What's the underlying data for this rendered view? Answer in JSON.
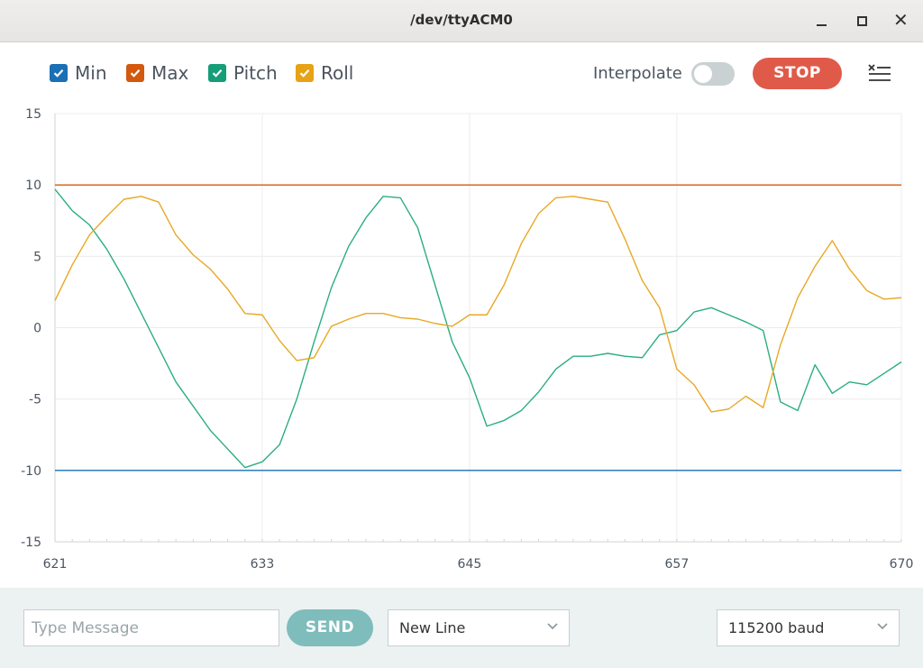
{
  "window": {
    "title": "/dev/ttyACM0"
  },
  "legend": [
    {
      "label": "Min",
      "color": "#1a6fb5"
    },
    {
      "label": "Max",
      "color": "#d3590e"
    },
    {
      "label": "Pitch",
      "color": "#159e78"
    },
    {
      "label": "Roll",
      "color": "#e8a215"
    }
  ],
  "toolbar": {
    "interpolate_label": "Interpolate",
    "interpolate_on": false,
    "stop_label": "STOP"
  },
  "bottom": {
    "message_placeholder": "Type Message",
    "send_label": "SEND",
    "line_ending": "New Line",
    "baud": "115200 baud"
  },
  "chart_data": {
    "type": "line",
    "x": [
      621,
      622,
      623,
      624,
      625,
      626,
      627,
      628,
      629,
      630,
      631,
      632,
      633,
      634,
      635,
      636,
      637,
      638,
      639,
      640,
      641,
      642,
      643,
      644,
      645,
      646,
      647,
      648,
      649,
      650,
      651,
      652,
      653,
      654,
      655,
      656,
      657,
      658,
      659,
      660,
      661,
      662,
      663,
      664,
      665,
      666,
      667,
      668,
      669,
      670
    ],
    "xticks": [
      621,
      633,
      645,
      657,
      670
    ],
    "yticks": [
      15,
      10,
      5,
      0,
      -5,
      -10,
      -15
    ],
    "ylim": [
      -15,
      15
    ],
    "xlim": [
      621,
      670
    ],
    "grid": true,
    "series": [
      {
        "name": "Min",
        "color": "#1a6fb5",
        "values": [
          -10,
          -10,
          -10,
          -10,
          -10,
          -10,
          -10,
          -10,
          -10,
          -10,
          -10,
          -10,
          -10,
          -10,
          -10,
          -10,
          -10,
          -10,
          -10,
          -10,
          -10,
          -10,
          -10,
          -10,
          -10,
          -10,
          -10,
          -10,
          -10,
          -10,
          -10,
          -10,
          -10,
          -10,
          -10,
          -10,
          -10,
          -10,
          -10,
          -10,
          -10,
          -10,
          -10,
          -10,
          -10,
          -10,
          -10,
          -10,
          -10,
          -10
        ]
      },
      {
        "name": "Max",
        "color": "#d3590e",
        "values": [
          10,
          10,
          10,
          10,
          10,
          10,
          10,
          10,
          10,
          10,
          10,
          10,
          10,
          10,
          10,
          10,
          10,
          10,
          10,
          10,
          10,
          10,
          10,
          10,
          10,
          10,
          10,
          10,
          10,
          10,
          10,
          10,
          10,
          10,
          10,
          10,
          10,
          10,
          10,
          10,
          10,
          10,
          10,
          10,
          10,
          10,
          10,
          10,
          10,
          10
        ]
      },
      {
        "name": "Pitch",
        "color": "#2bae80",
        "values": [
          9.7,
          8.2,
          7.2,
          5.5,
          3.4,
          1,
          -1.4,
          -3.8,
          -5.5,
          -7.2,
          -8.5,
          -9.8,
          -9.4,
          -8.2,
          -5,
          -1,
          2.8,
          5.7,
          7.7,
          9.2,
          9.1,
          7,
          3,
          -1,
          -3.5,
          -6.9,
          -6.5,
          -5.8,
          -4.5,
          -2.9,
          -2,
          -2,
          -1.8,
          -2,
          -2.1,
          -0.5,
          -0.2,
          1.1,
          1.4,
          0.9,
          0.4,
          -0.2,
          -5.2,
          -5.8,
          -2.6,
          -4.6,
          -3.8,
          -4,
          -3.2,
          -2.4
        ]
      },
      {
        "name": "Roll",
        "color": "#e8a825",
        "values": [
          1.9,
          4.4,
          6.5,
          7.8,
          9,
          9.2,
          8.8,
          6.5,
          5.1,
          4.1,
          2.7,
          1,
          0.9,
          -0.9,
          -2.3,
          -2.1,
          0.1,
          0.6,
          1,
          1,
          0.7,
          0.6,
          0.3,
          0.1,
          0.9,
          0.9,
          3,
          5.9,
          8,
          9.1,
          9.2,
          9,
          8.8,
          6.2,
          3.3,
          1.4,
          -2.9,
          -4,
          -5.9,
          -5.7,
          -4.8,
          -5.6,
          -1.2,
          2.1,
          4.3,
          6.1,
          4.1,
          2.6,
          2,
          2.1
        ]
      }
    ]
  }
}
